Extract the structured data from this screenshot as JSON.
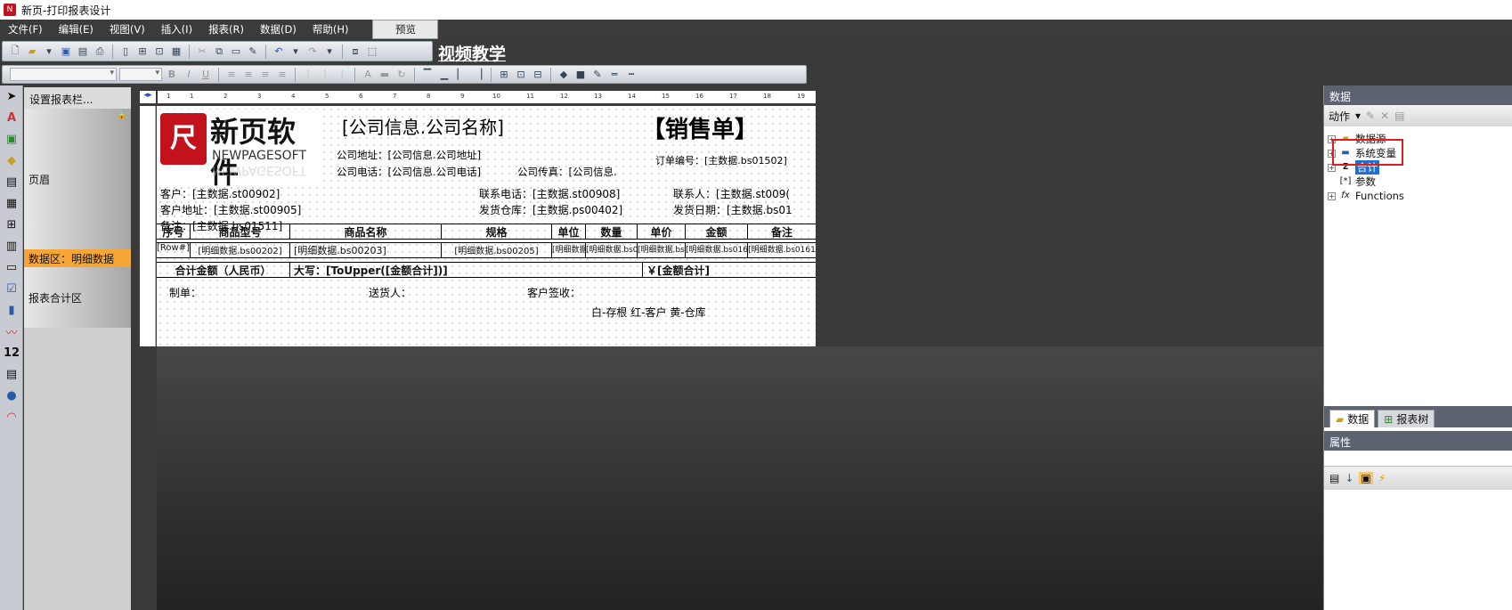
{
  "window": {
    "title": "新页-打印报表设计"
  },
  "menu": {
    "items": [
      "文件(F)",
      "编辑(E)",
      "视图(V)",
      "插入(I)",
      "报表(R)",
      "数据(D)",
      "帮助(H)"
    ],
    "preview": "预览"
  },
  "toolbar": {
    "video_label": "视频教学"
  },
  "bands": {
    "header": "设置报表栏...",
    "page_header": "页眉",
    "data_detail": "数据区：明细数据",
    "summary": "报表合计区"
  },
  "ruler": {
    "marks": [
      "1",
      "1",
      "2",
      "3",
      "4",
      "5",
      "6",
      "7",
      "8",
      "9",
      "10",
      "11",
      "12",
      "13",
      "14",
      "15",
      "16",
      "17",
      "18",
      "19"
    ]
  },
  "report": {
    "logo_cn": "新页软件",
    "logo_en": "NEWPAGESOFT",
    "company_name": "[公司信息.公司名称]",
    "doc_title": "【销售单】",
    "company_address": "公司地址：[公司信息.公司地址]",
    "company_phone": "公司电话：[公司信息.公司电话]",
    "company_fax": "公司传真：[公司信息.",
    "order_no": "订单编号：[主数据.bs01502]",
    "customer": "客户：[主数据.st00902]",
    "customer_address": "客户地址：[主数据.st00905]",
    "remark": "备注：[主数据.bs01511]",
    "contact_phone": "联系电话：[主数据.st00908]",
    "warehouse": "发货仓库：[主数据.ps00402]",
    "contact": "联系人：[主数据.st009(",
    "ship_date": "发货日期：[主数据.bs01",
    "columns": [
      "序号",
      "商品型号",
      "商品名称",
      "规格",
      "单位",
      "数量",
      "单价",
      "金额",
      "备注"
    ],
    "detail_row": [
      "[Row#]",
      "[明细数据.bs00202]",
      "[明细数据.bs00203]",
      "[明细数据.bs00205]",
      "[明细数据.s",
      "[明细数据.bs01",
      "[明细数据.bs0",
      "[明细数据.bs016",
      "[明细数据.bs0161"
    ],
    "total_label": "合计金额（人民币）",
    "total_upper": "大写：[ToUpper([金额合计])]",
    "total_amount": "￥[金额合计]",
    "maker": "制单：",
    "deliverer": "送货人：",
    "customer_sign": "客户签收：",
    "copies": "白-存根   红-客户   黄-仓库"
  },
  "data_panel": {
    "title": "数据",
    "action": "动作",
    "tree": [
      {
        "label": "数据源",
        "icon": "database-icon"
      },
      {
        "label": "系统变量",
        "icon": "system-variable-icon"
      },
      {
        "label": "合计",
        "icon": "sigma-icon"
      },
      {
        "label": "参数",
        "icon": "parameter-icon"
      },
      {
        "label": "Functions",
        "icon": "function-icon"
      }
    ],
    "tabs": [
      "数据",
      "报表树"
    ]
  },
  "props_panel": {
    "title": "属性"
  },
  "colors": {
    "accent_orange": "#f5a634",
    "selection_blue": "#1f6fd1",
    "highlight_red": "#e01d1d",
    "brand_red": "#c3121b"
  }
}
